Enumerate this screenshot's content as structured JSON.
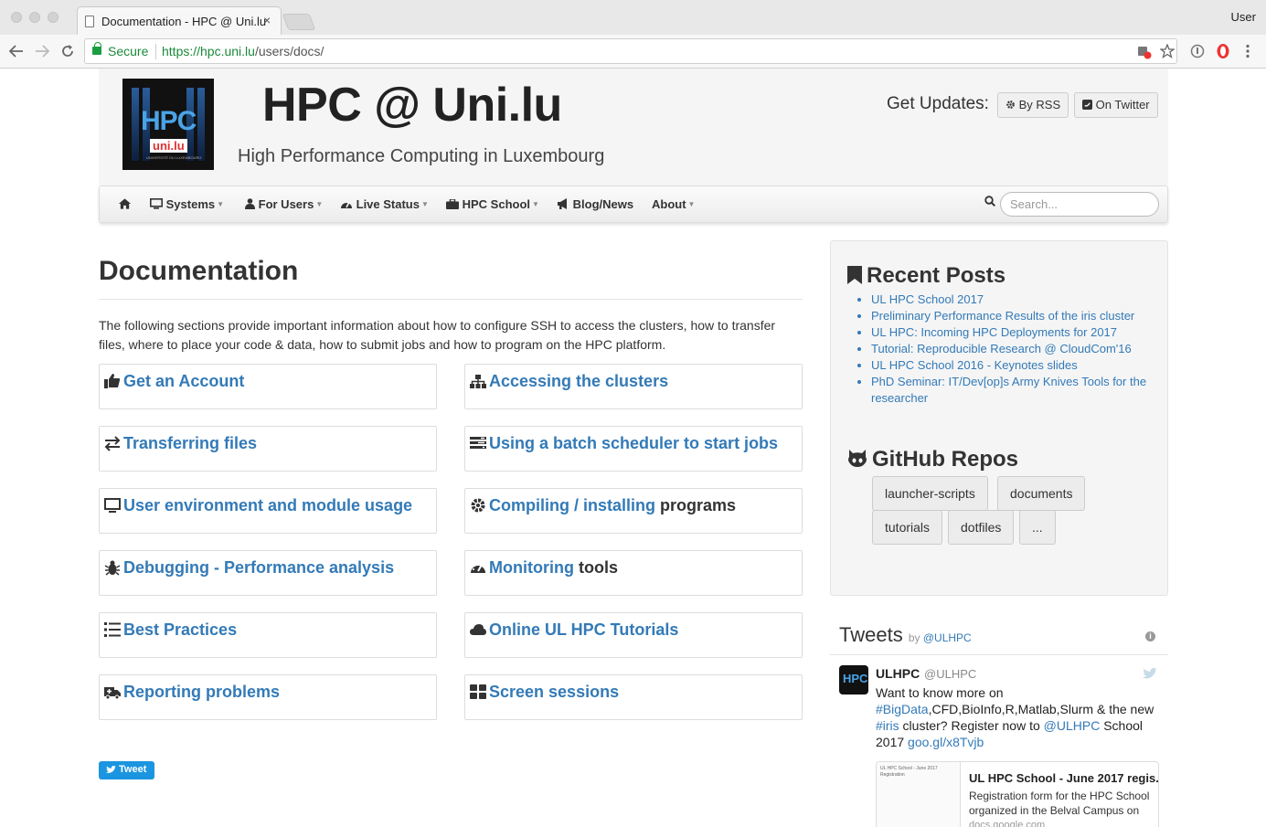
{
  "browser": {
    "tab_title": "Documentation - HPC @ Uni.lu",
    "tab_close": "×",
    "user": "User",
    "secure_label": "Secure",
    "url_scheme_host": "https://hpc.uni.lu",
    "url_path": "/users/docs/"
  },
  "header": {
    "logo_hpc": "HPC",
    "logo_unilu": "uni.lu",
    "logo_small": "UNIVERSITÉ DU LUXEMBOURG",
    "title": "HPC @ Uni.lu",
    "subtitle": "High Performance Computing in Luxembourg",
    "updates_label": "Get Updates:",
    "rss_button": "By RSS",
    "twitter_button": "On Twitter"
  },
  "nav": {
    "items": [
      {
        "label": "Systems"
      },
      {
        "label": "For Users"
      },
      {
        "label": "Live Status"
      },
      {
        "label": "HPC School"
      },
      {
        "label": "Blog/News"
      },
      {
        "label": "About"
      }
    ],
    "search_placeholder": "Search..."
  },
  "main": {
    "title": "Documentation",
    "intro": "The following sections provide important information about how to configure SSH to access the clusters, how to transfer files, where to place your code & data, how to submit jobs and how to program on the HPC platform.",
    "cards": [
      {
        "label": "Get an Account",
        "icon": "thumbs-up-icon"
      },
      {
        "label": "Accessing the clusters",
        "icon": "sitemap-icon"
      },
      {
        "label": "Transferring files",
        "icon": "exchange-icon"
      },
      {
        "label": "Using a batch scheduler to start jobs",
        "icon": "tasks-icon"
      },
      {
        "label": "User environment and module usage",
        "icon": "desktop-icon"
      },
      {
        "label": "Compiling / installing",
        "label_plain": "programs",
        "icon": "gear-icon"
      },
      {
        "label": "Debugging - Performance analysis",
        "icon": "bug-icon"
      },
      {
        "label": "Monitoring",
        "label_plain": "tools",
        "icon": "dashboard-icon"
      },
      {
        "label": "Best Practices",
        "icon": "list-icon"
      },
      {
        "label": "Online UL HPC Tutorials",
        "icon": "cloud-icon"
      },
      {
        "label": "Reporting problems",
        "icon": "ambulance-icon"
      },
      {
        "label": "Screen sessions",
        "icon": "th-large-icon"
      }
    ],
    "tweet_button": "Tweet"
  },
  "sidebar": {
    "recent_posts_title": "Recent Posts",
    "recent_posts": [
      "UL HPC School 2017",
      "Preliminary Performance Results of the iris cluster",
      "UL HPC: Incoming HPC Deployments for 2017",
      "Tutorial: Reproducible Research @ CloudCom'16",
      "UL HPC School 2016 - Keynotes slides",
      "PhD Seminar: IT/Dev[op]s Army Knives Tools for the researcher"
    ],
    "github_title": "GitHub Repos",
    "repos": [
      "launcher-scripts",
      "documents",
      "tutorials",
      "dotfiles",
      "..."
    ]
  },
  "tweets": {
    "header": "Tweets",
    "by": "by",
    "by_handle": "@ULHPC",
    "info": "i",
    "author_name": "ULHPC",
    "author_handle": "@ULHPC",
    "avatar_text": "HPC",
    "text_1": "Want to know more on ",
    "hashtag_bigdata": "#BigData",
    "text_2": ",CFD,BioInfo,R,Matlab,Slurm & the new ",
    "hashtag_iris": "#iris",
    "text_3": " cluster? Register now to ",
    "mention": "@ULHPC",
    "text_4": " School 2017 ",
    "short_link": "goo.gl/x8Tvjb",
    "card_thumb_text": "UL HPC School - June 2017 Registration",
    "card_title": "UL HPC School - June 2017 regis..",
    "card_desc": "Registration form for the HPC School organized in the Belval Campus on",
    "card_url": "docs.google.com"
  },
  "colors": {
    "link": "#337ab7",
    "secure_green": "#1a8a3a",
    "twitter_blue": "#1b95e0"
  }
}
